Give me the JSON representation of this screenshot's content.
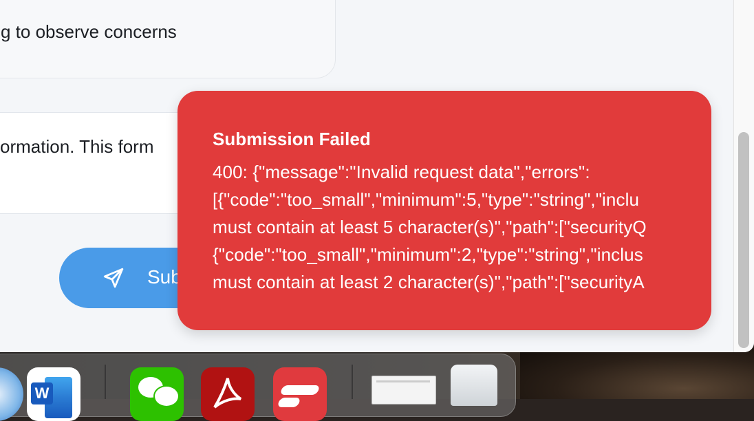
{
  "chat": {
    "bubble_text": "g to observe concerns"
  },
  "info": {
    "text": "ormation. This form"
  },
  "submit": {
    "label": "Sub",
    "icon": "send-icon"
  },
  "toast": {
    "title": "Submission Failed",
    "lines": [
      "400: {\"message\":\"Invalid request data\",\"errors\":",
      "[{\"code\":\"too_small\",\"minimum\":5,\"type\":\"string\",\"inclu",
      "must contain at least 5 character(s)\",\"path\":[\"securityQ",
      "{\"code\":\"too_small\",\"minimum\":2,\"type\":\"string\",\"inclus",
      "must contain at least 2 character(s)\",\"path\":[\"securityA"
    ],
    "bg_color": "#e13b3b"
  },
  "dock": {
    "icons": [
      "safari-icon",
      "word-icon",
      "wechat-icon",
      "acrobat-icon",
      "red-app-icon",
      "preview-document-icon",
      "trash-icon"
    ],
    "word_letter": "W"
  },
  "colors": {
    "accent": "#4a9be8",
    "error": "#e13b3b"
  }
}
